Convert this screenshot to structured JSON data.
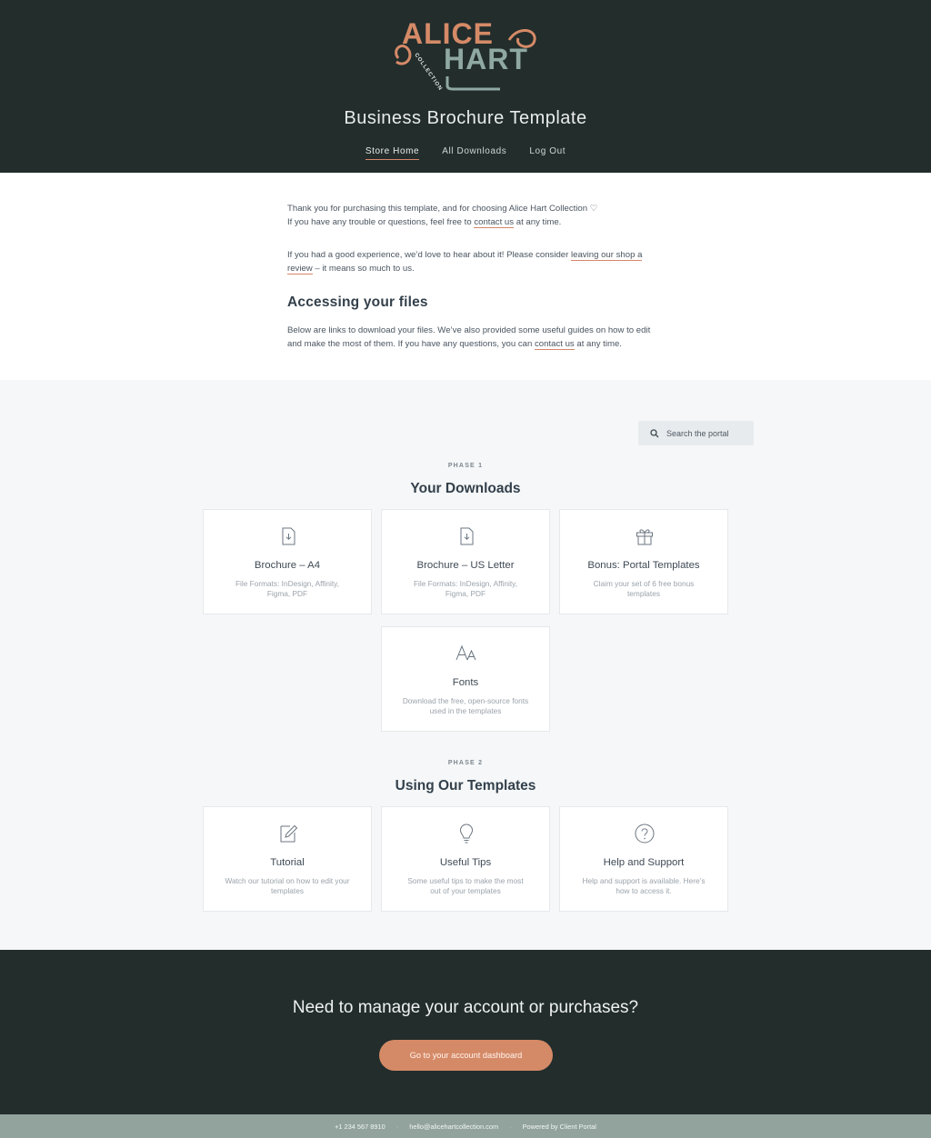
{
  "header": {
    "logo": {
      "line1": "ALICE",
      "line2": "HART",
      "tagline": "COLLECTION"
    },
    "title": "Business Brochure Template",
    "nav": [
      {
        "label": "Store Home",
        "active": true
      },
      {
        "label": "All Downloads",
        "active": false
      },
      {
        "label": "Log Out",
        "active": false
      }
    ]
  },
  "intro": {
    "p1_text": "Thank you for purchasing this template, and for choosing Alice Hart Collection ♡",
    "p1_line2_pre": "If you have any trouble or questions, feel free to ",
    "p1_link": "contact us",
    "p1_line2_post": " at any time.",
    "p2_pre": "If you had a good experience, we’d love to hear about it! Please consider ",
    "p2_link": "leaving our shop a review",
    "p2_post": " – it means so much to us.",
    "heading": "Accessing your files",
    "p3_pre": "Below are links to download your files. We’ve also provided some useful guides on how to edit and make the most of them. If you have any questions, you can ",
    "p3_link": "contact us",
    "p3_post": " at any time."
  },
  "search": {
    "placeholder": "Search the portal",
    "icon": "search-icon"
  },
  "phase1": {
    "label": "PHASE 1",
    "title": "Your Downloads",
    "cards": [
      {
        "title": "Brochure – A4",
        "desc": "File Formats: InDesign, Affinity, Figma, PDF",
        "icon": "file-download-icon"
      },
      {
        "title": "Brochure – US Letter",
        "desc": "File Formats: InDesign, Affinity, Figma, PDF",
        "icon": "file-download-icon"
      },
      {
        "title": "Bonus: Portal Templates",
        "desc": "Claim your set of 6 free bonus templates",
        "icon": "gift-icon"
      },
      {
        "title": "Fonts",
        "desc": "Download the free, open-source fonts used in the templates",
        "icon": "font-icon"
      }
    ]
  },
  "phase2": {
    "label": "PHASE 2",
    "title": "Using Our Templates",
    "cards": [
      {
        "title": "Tutorial",
        "desc": "Watch our tutorial on how to edit your templates",
        "icon": "edit-icon"
      },
      {
        "title": "Useful Tips",
        "desc": "Some useful tips to make the most out of your templates",
        "icon": "lightbulb-icon"
      },
      {
        "title": "Help and Support",
        "desc": "Help and support is available. Here’s how to access it.",
        "icon": "help-icon"
      }
    ]
  },
  "cta": {
    "title": "Need to manage your account or purchases?",
    "button": "Go to your account dashboard"
  },
  "footer": {
    "phone": "+1 234 567 8910",
    "email": "hello@alicehartcollection.com",
    "powered": "Powered by Client Portal",
    "separator": "·"
  },
  "colors": {
    "dark": "#222d2c",
    "accent": "#d58a67",
    "sage": "#91a39c",
    "logo_teal": "#8fa8a2"
  }
}
